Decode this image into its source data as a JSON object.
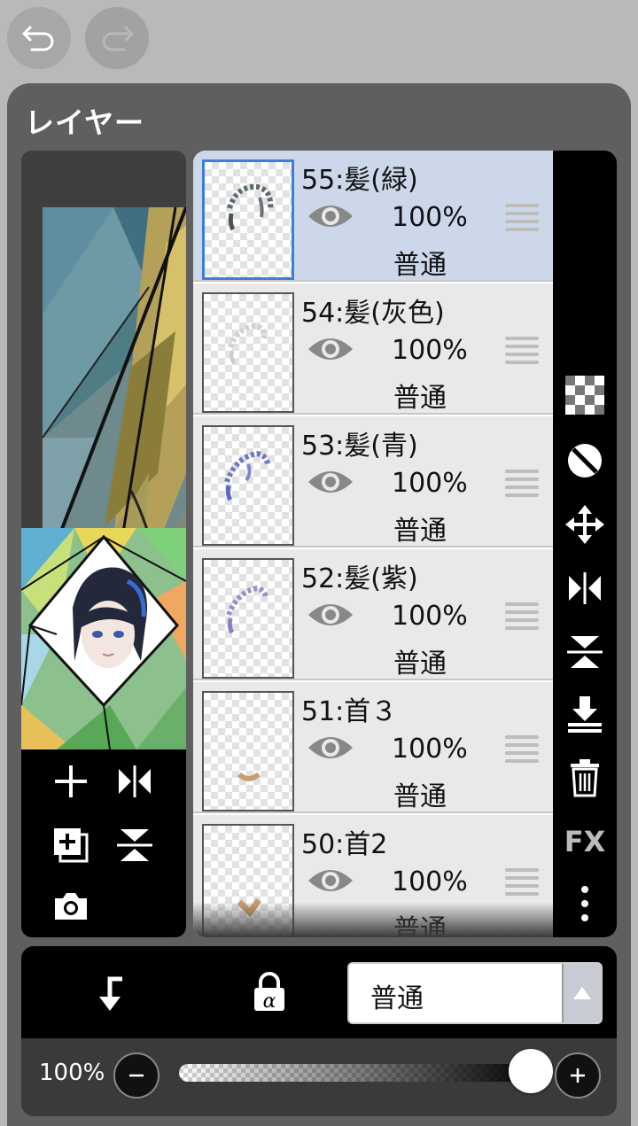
{
  "app": {
    "undo_icon": "undo-icon",
    "redo_icon": "redo-icon"
  },
  "panel": {
    "title": "レイヤー"
  },
  "layers": [
    {
      "name": "55:髪(緑)",
      "opacity": "100%",
      "blend": "普通",
      "selected": true,
      "visibility_icon": "eye-icon"
    },
    {
      "name": "54:髪(灰色)",
      "opacity": "100%",
      "blend": "普通",
      "selected": false,
      "visibility_icon": "eye-icon"
    },
    {
      "name": "53:髪(青)",
      "opacity": "100%",
      "blend": "普通",
      "selected": false,
      "visibility_icon": "eye-icon"
    },
    {
      "name": "52:髪(紫)",
      "opacity": "100%",
      "blend": "普通",
      "selected": false,
      "visibility_icon": "eye-icon"
    },
    {
      "name": "51:首３",
      "opacity": "100%",
      "blend": "普通",
      "selected": false,
      "visibility_icon": "eye-icon"
    },
    {
      "name": "50:首2",
      "opacity": "100%",
      "blend": "普通",
      "selected": false,
      "visibility_icon": "eye-icon"
    }
  ],
  "right_tools": [
    "transparency-icon",
    "clip-icon",
    "move-icon",
    "flip-horizontal-icon",
    "flip-vertical-icon",
    "merge-down-icon",
    "delete-icon",
    "fx-icon",
    "more-icon"
  ],
  "right_tools_fx_label": "FX",
  "left_tools": [
    "add-layer-icon",
    "flip-horizontal-icon",
    "duplicate-layer-icon",
    "flip-vertical-icon",
    "camera-icon"
  ],
  "bottom": {
    "blend_mode": "普通",
    "opacity_label": "100%",
    "opacity_value": 1.0,
    "clip_icon": "clipping-arrow-icon",
    "alpha_lock_icon": "alpha-lock-icon"
  },
  "colors": {
    "accent": "#3d7fd8",
    "selected_row": "#ccd8ea",
    "panel": "#5f5f5f"
  }
}
